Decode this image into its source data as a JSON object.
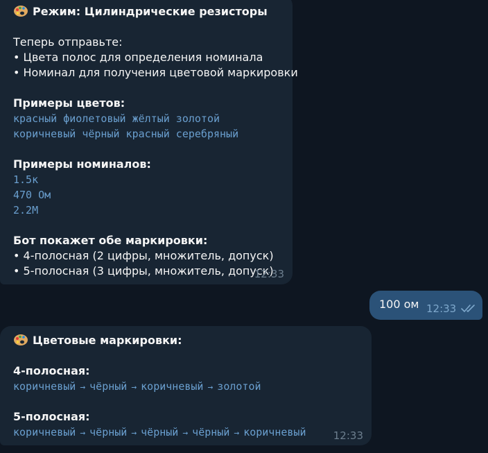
{
  "messages": {
    "mode": {
      "emoji": "palette-icon",
      "title": "Режим: Цилиндрические резисторы",
      "send_now": "Теперь отправьте:",
      "bullets": [
        "• Цвета полос для определения номинала",
        "• Номинал для получения цветовой маркировки"
      ],
      "color_examples_title": "Примеры цветов:",
      "color_examples": [
        "красный фиолетовый жёлтый золотой",
        "коричневый чёрный красный серебряный"
      ],
      "value_examples_title": "Примеры номиналов:",
      "value_examples": [
        "1.5к",
        "470 Ом",
        "2.2М"
      ],
      "both_title": "Бот покажет обе маркировки:",
      "both_bullets": [
        "• 4-полосная (2 цифры, множитель, допуск)",
        "• 5-полосная (3 цифры, множитель, допуск)"
      ],
      "time": "12:33"
    },
    "user": {
      "text": "100 ом",
      "time": "12:33",
      "status": "read-double-check-icon"
    },
    "result": {
      "emoji": "palette-icon",
      "title": "Цветовые маркировки:",
      "four_band_title": "4-полосная:",
      "four_band": [
        "коричневый",
        "чёрный",
        "коричневый",
        "золотой"
      ],
      "five_band_title": "5-полосная:",
      "five_band": [
        "коричневый",
        "чёрный",
        "чёрный",
        "чёрный",
        "коричневый"
      ],
      "arrow": "→",
      "time": "12:33"
    }
  },
  "colors": {
    "background": "#0e1621",
    "incoming_bubble": "#182533",
    "outgoing_bubble": "#2b5278",
    "code_text": "#6a9fcf",
    "timestamp": "#6d7f8f"
  }
}
